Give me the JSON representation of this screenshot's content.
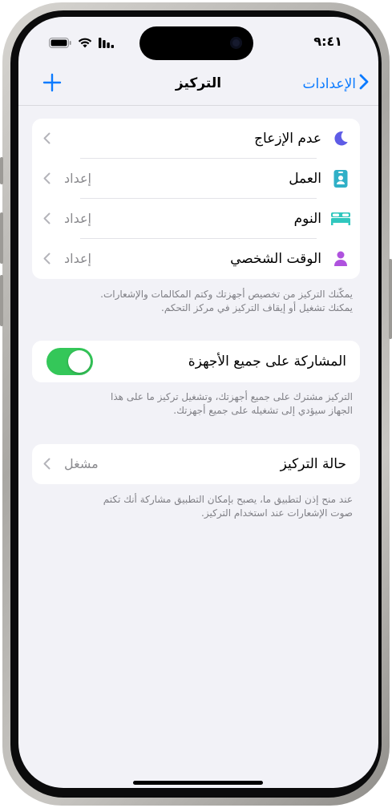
{
  "status": {
    "time": "٩:٤١"
  },
  "nav": {
    "back_label": "الإعدادات",
    "title": "التركيز"
  },
  "focus_modes": [
    {
      "label": "عدم الإزعاج",
      "value": "",
      "icon": "moon-icon",
      "color": "#5e5ce6"
    },
    {
      "label": "العمل",
      "value": "إعداد",
      "icon": "id-badge-icon",
      "color": "#30b0c7"
    },
    {
      "label": "النوم",
      "value": "إعداد",
      "icon": "bed-icon",
      "color": "#30c7be"
    },
    {
      "label": "الوقت الشخصي",
      "value": "إعداد",
      "icon": "person-icon",
      "color": "#af52de"
    }
  ],
  "focus_note": {
    "line1": "يمكّنك التركيز من تخصيص أجهزتك وكتم المكالمات والإشعارات.",
    "line2": "يمكنك تشغيل أو إيقاف التركيز في مركز التحكم."
  },
  "share": {
    "label": "المشاركة على جميع الأجهزة",
    "enabled": true,
    "note_line1": "التركيز مشترك على جميع أجهزتك، وتشغيل تركيز ما على هذا",
    "note_line2": "الجهاز سيؤدي إلى تشغيله على جميع أجهزتك."
  },
  "status_row": {
    "label": "حالة التركيز",
    "value": "مشغل",
    "note_line1": "عند منح إذن لتطبيق ما، يصبح بإمكان التطبيق مشاركة أنك تكتم",
    "note_line2": "صوت الإشعارات عند استخدام التركيز."
  },
  "colors": {
    "accent": "#0a7aff",
    "toggle_on": "#34c759",
    "background": "#f2f2f7"
  }
}
